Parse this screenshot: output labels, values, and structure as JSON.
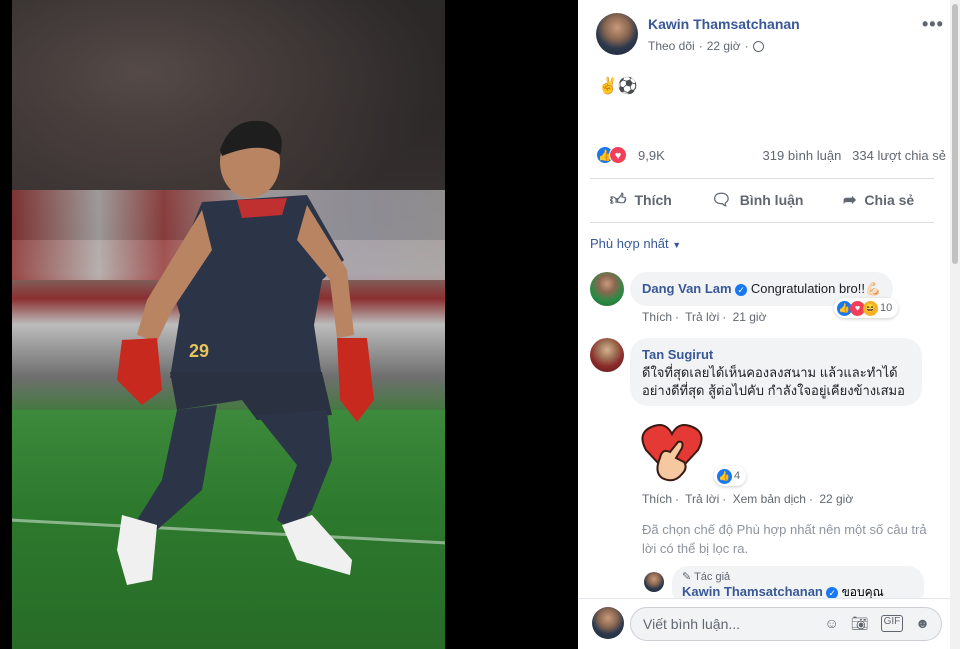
{
  "post": {
    "author": "Kawin Thamsatchanan",
    "follow": "Theo dõi",
    "time": "22 giờ",
    "text": "✌️⚽",
    "player_number": "29",
    "reaction_count": "9,9K",
    "comments_count": "319 bình luận",
    "shares_count": "334 lượt chia sẻ"
  },
  "actions": {
    "like": "Thích",
    "comment": "Bình luận",
    "share": "Chia sẻ"
  },
  "sort_label": "Phù hợp nhất",
  "comments": [
    {
      "name": "Dang Van Lam",
      "text": "Congratulation bro!!💪🏻",
      "like": "Thích",
      "reply": "Trả lời",
      "time": "21 giờ",
      "reactions": "10"
    },
    {
      "name": "Tan Sugirut",
      "text": "ดีใจที่สุดเลยได้เห็นคองลงสนาม แล้วและทำได้อย่างดีที่สุด สู้ต่อไปคับ กำลังใจอยู่เคียงข้างเสมอ",
      "like": "Thích",
      "reply": "Trả lời",
      "translate": "Xem bản dịch",
      "time": "22 giờ",
      "reactions": "4"
    }
  ],
  "filter_note": "Đã chọn chế độ Phù hợp nhất nên một số câu trả lời có thể bị lọc ra.",
  "reply": {
    "tag": "Tác giả",
    "name": "Kawin Thamsatchanan",
    "text": "ขอบคุณ"
  },
  "composer": {
    "placeholder": "Viết bình luận..."
  },
  "colors": {
    "link": "#385898",
    "like_blue": "#1877f2",
    "love_red": "#f33e58"
  }
}
